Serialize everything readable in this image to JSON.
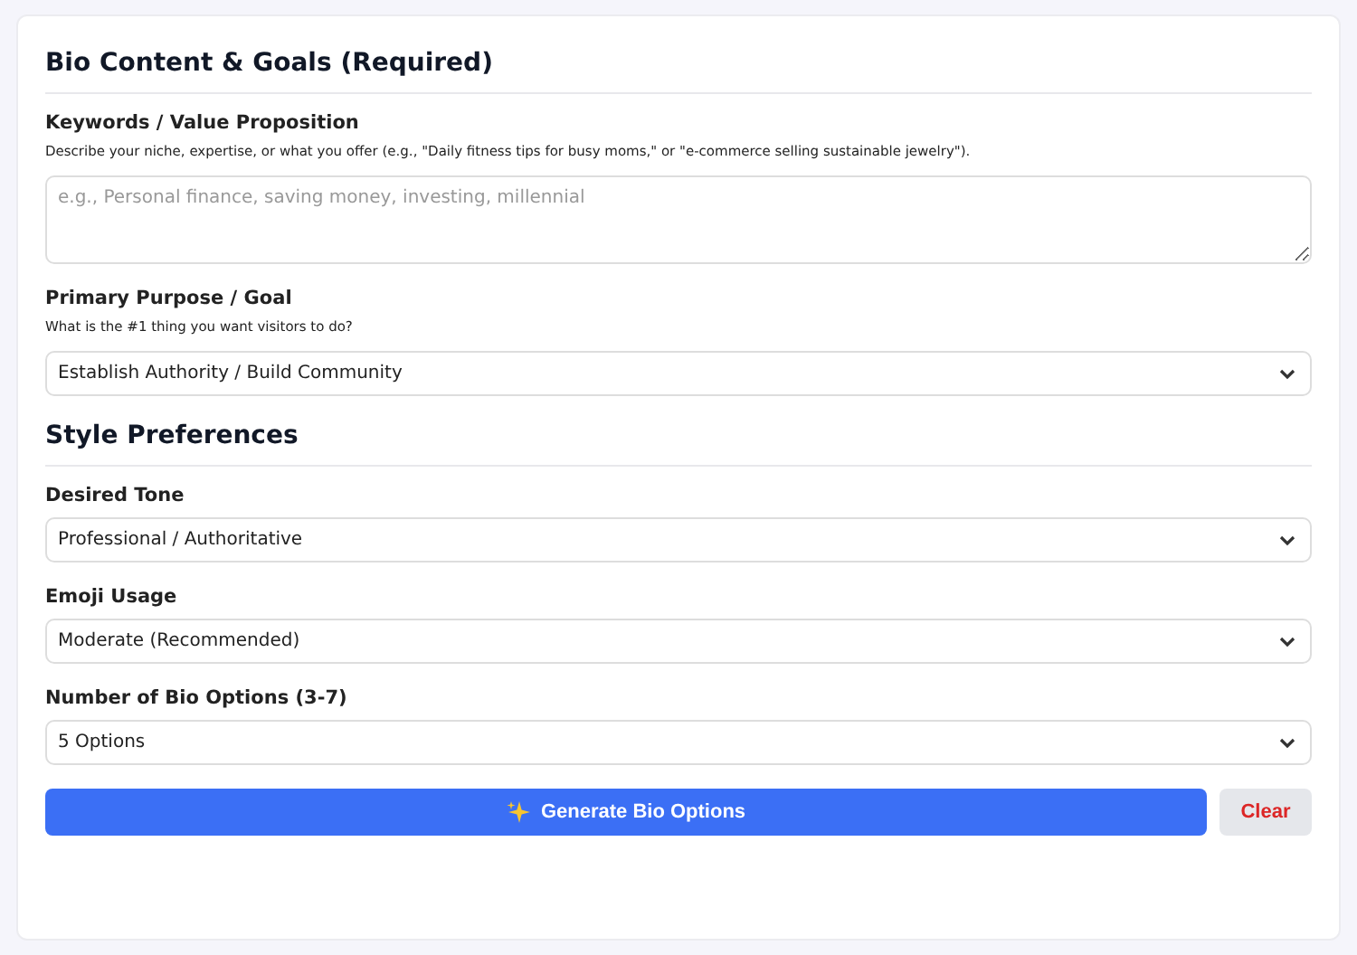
{
  "sections": [
    {
      "title": "Bio Content & Goals (Required)",
      "fields": [
        {
          "kind": "textarea",
          "label": "Keywords / Value Proposition",
          "hint": "Describe your niche, expertise, or what you offer (e.g., \"Daily fitness tips for busy moms,\" or \"e-commerce selling sustainable jewelry\").",
          "placeholder": "e.g., Personal finance, saving money, investing, millennial"
        },
        {
          "kind": "select",
          "label": "Primary Purpose / Goal",
          "hint": "What is the #1 thing you want visitors to do?",
          "value": "Establish Authority / Build Community"
        }
      ]
    },
    {
      "title": "Style Preferences",
      "fields": [
        {
          "kind": "select",
          "label": "Desired Tone",
          "value": "Professional / Authoritative"
        },
        {
          "kind": "select",
          "label": "Emoji Usage",
          "value": "Moderate (Recommended)"
        },
        {
          "kind": "select",
          "label": "Number of Bio Options (3-7)",
          "value": "5 Options"
        }
      ]
    }
  ],
  "buttons": {
    "primary": "Generate Bio Options",
    "secondary": "Clear"
  }
}
